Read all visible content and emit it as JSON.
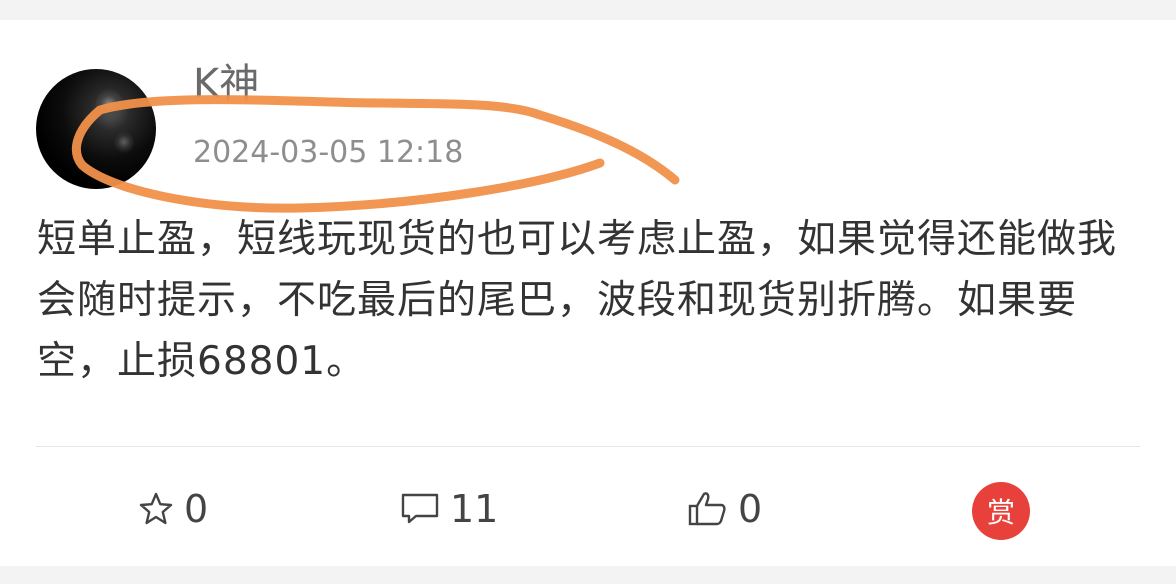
{
  "post": {
    "username": "K神",
    "timestamp": "2024-03-05 12:18",
    "content": "短单止盈，短线玩现货的也可以考虑止盈，如果觉得还能做我会随时提示，不吃最后的尾巴，波段和现货别折腾。如果要空，止损68801。"
  },
  "actions": {
    "favorite_count": "0",
    "comment_count": "11",
    "like_count": "0",
    "reward_label": "赏"
  },
  "colors": {
    "reward_bg": "#e8403a",
    "annotation": "#f0914a"
  },
  "icons": [
    "avatar",
    "star-icon",
    "comment-icon",
    "thumbs-up-icon",
    "reward-icon"
  ]
}
